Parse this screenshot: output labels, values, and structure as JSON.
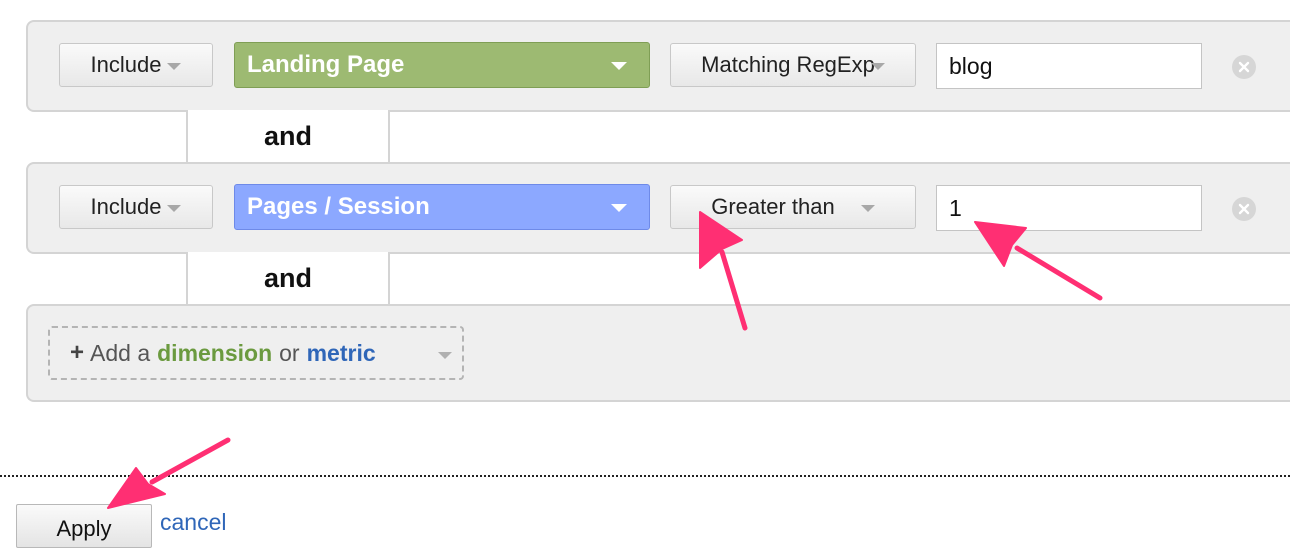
{
  "rows": [
    {
      "include_label": "Include",
      "field_label": "Landing Page",
      "field_kind": "dimension",
      "field_color": "#9dba72",
      "operator_label": "Matching RegExp",
      "value": "blog"
    },
    {
      "include_label": "Include",
      "field_label": "Pages / Session",
      "field_kind": "metric",
      "field_color": "#8ca8ff",
      "operator_label": "Greater than",
      "value": "1"
    }
  ],
  "connectors": [
    "and",
    "and"
  ],
  "add_filter": {
    "plus": "+",
    "prefix": "Add a",
    "dimension_word": "dimension",
    "or_word": "or",
    "metric_word": "metric",
    "dimension_color": "#6b9a3f",
    "metric_color": "#2f66b8"
  },
  "footer": {
    "apply_label": "Apply",
    "cancel_label": "cancel"
  },
  "annotations": {
    "arrow_color": "#ff2f73"
  },
  "icons": {
    "remove": "close-circle-icon",
    "dropdown": "chevron-down-icon"
  }
}
